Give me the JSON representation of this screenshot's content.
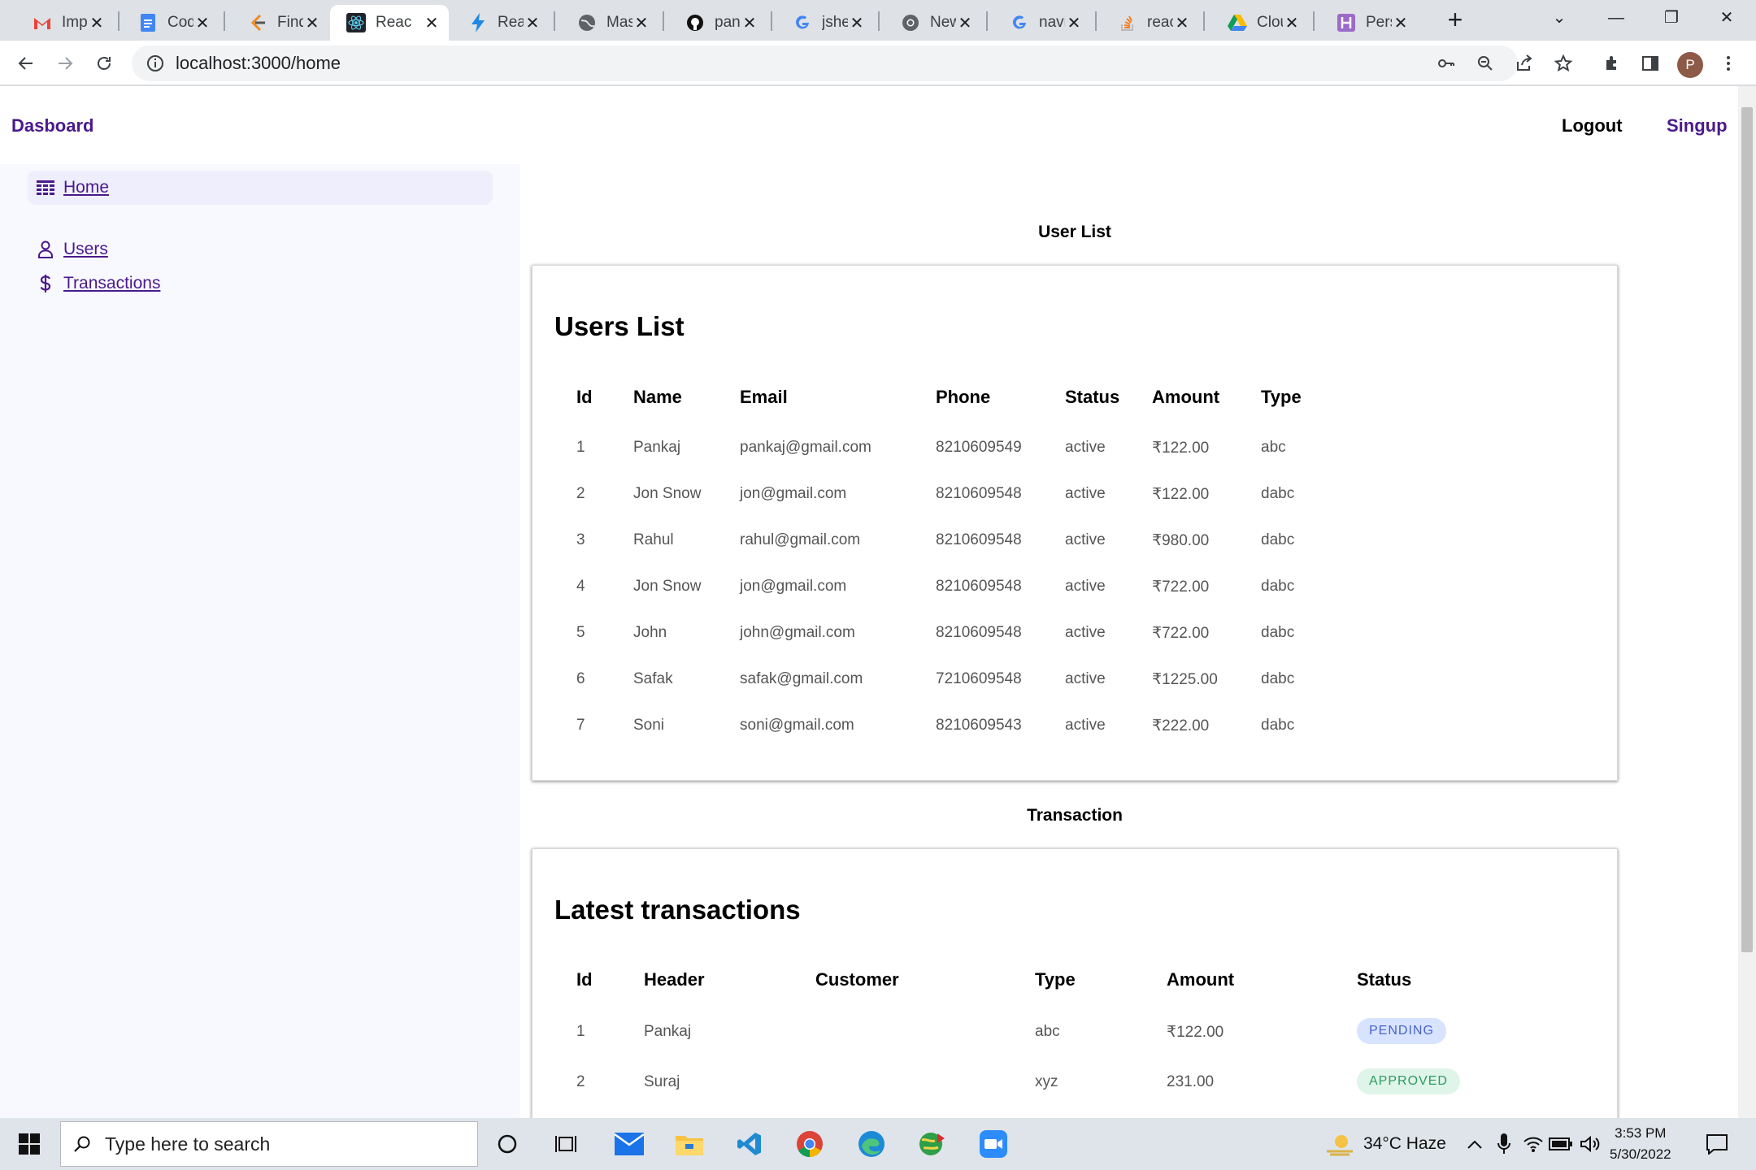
{
  "browser": {
    "tabs": [
      {
        "title": "Impo",
        "icon": "gmail-icon"
      },
      {
        "title": "Code",
        "icon": "docs-icon"
      },
      {
        "title": "Find",
        "icon": "find-icon"
      },
      {
        "title": "Reac",
        "icon": "react-icon",
        "active": true
      },
      {
        "title": "Reac",
        "icon": "bolt-icon"
      },
      {
        "title": "Mas",
        "icon": "globe-icon"
      },
      {
        "title": "pank",
        "icon": "github-icon"
      },
      {
        "title": "jshel",
        "icon": "google-icon"
      },
      {
        "title": "New",
        "icon": "chrome-icon"
      },
      {
        "title": "navic",
        "icon": "google-icon"
      },
      {
        "title": "reacl",
        "icon": "stackoverflow-icon"
      },
      {
        "title": "Clou",
        "icon": "drive-icon"
      },
      {
        "title": "Pers",
        "icon": "h-icon"
      }
    ],
    "new_tab": "+",
    "url": "localhost:3000/home",
    "profile_initial": "P"
  },
  "header": {
    "brand": "Dasboard",
    "logout": "Logout",
    "signup": "Singup"
  },
  "sidebar": {
    "items": [
      {
        "label": "Home",
        "icon": "dashboard-icon",
        "active": true
      },
      {
        "label": "Users",
        "icon": "user-icon"
      },
      {
        "label": "Transactions",
        "icon": "dollar-icon"
      }
    ]
  },
  "users_section": {
    "section_title": "User List",
    "card_title": "Users List",
    "columns": [
      "Id",
      "Name",
      "Email",
      "Phone",
      "Status",
      "Amount",
      "Type"
    ],
    "rows": [
      [
        "1",
        "Pankaj",
        "pankaj@gmail.com",
        "8210609549",
        "active",
        "₹122.00",
        "abc"
      ],
      [
        "2",
        "Jon Snow",
        "jon@gmail.com",
        "8210609548",
        "active",
        "₹122.00",
        "dabc"
      ],
      [
        "3",
        "Rahul",
        "rahul@gmail.com",
        "8210609548",
        "active",
        "₹980.00",
        "dabc"
      ],
      [
        "4",
        "Jon Snow",
        "jon@gmail.com",
        "8210609548",
        "active",
        "₹722.00",
        "dabc"
      ],
      [
        "5",
        "John",
        "john@gmail.com",
        "8210609548",
        "active",
        "₹722.00",
        "dabc"
      ],
      [
        "6",
        "Safak",
        "safak@gmail.com",
        "7210609548",
        "active",
        "₹1225.00",
        "dabc"
      ],
      [
        "7",
        "Soni",
        "soni@gmail.com",
        "8210609543",
        "active",
        "₹222.00",
        "dabc"
      ]
    ]
  },
  "transactions_section": {
    "section_title": "Transaction",
    "card_title": "Latest transactions",
    "columns": [
      "Id",
      "Header",
      "Customer",
      "Type",
      "Amount",
      "Status"
    ],
    "rows": [
      {
        "id": "1",
        "header": "Pankaj",
        "customer": "",
        "type": "abc",
        "amount": "₹122.00",
        "status": "PENDING",
        "status_kind": "pending"
      },
      {
        "id": "2",
        "header": "Suraj",
        "customer": "",
        "type": "xyz",
        "amount": "231.00",
        "status": "APPROVED",
        "status_kind": "approved"
      }
    ]
  },
  "taskbar": {
    "search_placeholder": "Type here to search",
    "weather": "34°C  Haze",
    "time": "3:53 PM",
    "date": "5/30/2022"
  },
  "colors": {
    "brand": "#4a1a8c",
    "sidebar_bg": "#f8f8ff",
    "pending_bg": "#d7e3ff",
    "approved_bg": "#dff5e9"
  }
}
